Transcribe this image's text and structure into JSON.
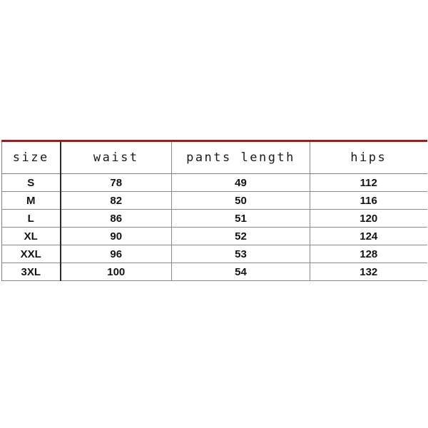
{
  "table": {
    "columns": [
      {
        "key": "size",
        "header": "size"
      },
      {
        "key": "waist",
        "header": "waist"
      },
      {
        "key": "length",
        "header": "pants length"
      },
      {
        "key": "hips",
        "header": "hips"
      }
    ],
    "rows": [
      {
        "size": "S",
        "waist": "78",
        "length": "49",
        "hips": "112"
      },
      {
        "size": "M",
        "waist": "82",
        "length": "50",
        "hips": "116"
      },
      {
        "size": "L",
        "waist": "86",
        "length": "51",
        "hips": "120"
      },
      {
        "size": "XL",
        "waist": "90",
        "length": "52",
        "hips": "124"
      },
      {
        "size": "XXL",
        "waist": "96",
        "length": "53",
        "hips": "128"
      },
      {
        "size": "3XL",
        "waist": "100",
        "length": "54",
        "hips": "132"
      }
    ]
  },
  "colors": {
    "top_border": "#8b2424",
    "grid_line": "#8a8a8a",
    "divider_dark": "#2a2a2a",
    "text": "#131313",
    "background": "#ffffff"
  }
}
